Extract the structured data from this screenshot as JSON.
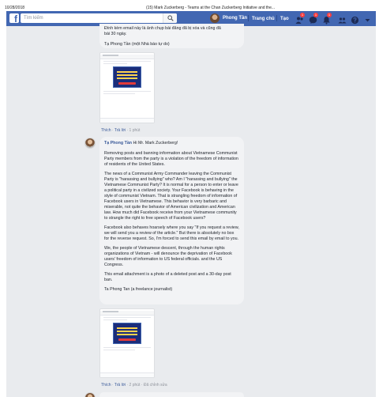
{
  "print_header": {
    "date": "10/28/2018",
    "title": "(15) Mark Zuckerberg - Teams at the Chan Zuckerberg Initiative and the..."
  },
  "topbar": {
    "logo": "f",
    "search_placeholder": "Tìm kiếm",
    "user_name": "Phong Tần",
    "home_label": "Trang chủ",
    "create_label": "Tạo",
    "friend_badge": "1",
    "messages_badge": "1",
    "notifications_badge": "1",
    "brand_color": "#4267b2"
  },
  "comment1": {
    "text_lines": [
      "Đính kèm email này là ảnh chụp bài đăng đã bị xóa và cũng đã",
      "bài 30 ngày."
    ],
    "signature": "Tạ Phong Tần (một Nhà báo tự do)",
    "like": "Thích",
    "reply": "Trả lời",
    "time": "1 phút"
  },
  "comment2": {
    "author": "Tạ Phong Tần",
    "greeting": "Hi Mr. Mark Zuckerberg!",
    "paragraphs": [
      "Removing posts and banning information about Vietnamese Communist Party members from the party is a violation of the freedom of information of residents of the United States.",
      "The news of a Communist Army Commander leaving the Communist Party is \"harassing and bullying\" who? Am I \"harassing and bullying\" the Vietnamese Communist Party? It is normal for a person to enter or leave a political party in a civilized society. Your Facebook is behaving in the style of communist Vietnam. That is strangling freedom of information of Facebook users in Vietnamese. This behavior is very barbaric and miserable, not quite the behavior of American civilization and American law. How much did Facebook receive from your Vietnamese community to strangle the right to free speech of Facebook users?",
      "Facebook also behaves hoarsely where you say \"If you request a review, we will send you a review of the article.\" But there is absolutely no box for the reverse request. So, I'm forced to send this email by email to you.",
      "We, the people of Vietnamese descent, through the human rights organizations of Vietnam - will denounce the deprivation of Facebook users' freedom of information to US federal officials. and the US Congress.",
      "This email attachment is a photo of a deleted post and a 30-day post ban.",
      "Ta Phong Tan (a freelance journalist)"
    ],
    "like": "Thích",
    "reply": "Trả lời",
    "time": "2 phút",
    "edited": "Đã chỉnh sửa"
  }
}
